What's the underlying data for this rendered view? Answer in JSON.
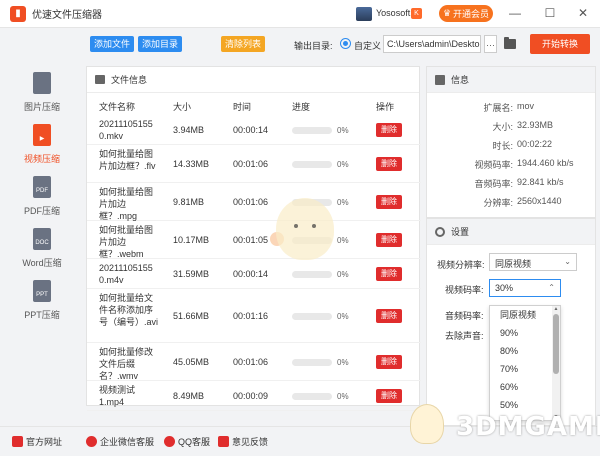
{
  "titlebar": {
    "app_icon": "film-icon",
    "title": "优速文件压缩器",
    "username": "Yososoft",
    "vip_label": "开通会员"
  },
  "toolbar": {
    "add_file": "添加文件",
    "add_dir": "添加目录",
    "clear_list": "清除列表",
    "output_label": "输出目录:",
    "custom_label": "自定义",
    "output_path": "C:\\Users\\admin\\Deskto",
    "browse_label": "···",
    "start_label": "开始转换"
  },
  "sidebar": {
    "items": [
      {
        "label": "图片压缩",
        "icon": "image-icon",
        "glyph": ""
      },
      {
        "label": "视频压缩",
        "icon": "video-icon",
        "glyph": "▶"
      },
      {
        "label": "PDF压缩",
        "icon": "pdf-icon",
        "glyph": "PDF"
      },
      {
        "label": "Word压缩",
        "icon": "doc-icon",
        "glyph": "DOC"
      },
      {
        "label": "PPT压缩",
        "icon": "ppt-icon",
        "glyph": "PPT"
      }
    ]
  },
  "file_panel": {
    "title": "文件信息",
    "columns": [
      "文件名称",
      "大小",
      "时间",
      "进度",
      "操作"
    ],
    "rows": [
      {
        "name": "20211105155 0.mkv",
        "size": "3.94MB",
        "time": "00:00:14",
        "progress": 0,
        "pct": "0%",
        "action": "删除"
      },
      {
        "name": "如何批量给图片加边框？.flv",
        "size": "14.33MB",
        "time": "00:01:06",
        "progress": 0,
        "pct": "0%",
        "action": "删除"
      },
      {
        "name": "如何批量给图片加边框？.mpg",
        "size": "9.81MB",
        "time": "00:01:06",
        "progress": 0,
        "pct": "0%",
        "action": "删除"
      },
      {
        "name": "如何批量给图片加边框？.webm",
        "size": "10.17MB",
        "time": "00:01:05",
        "progress": 0,
        "pct": "0%",
        "action": "删除"
      },
      {
        "name": "20211105155 0.m4v",
        "size": "31.59MB",
        "time": "00:00:14",
        "progress": 0,
        "pct": "0%",
        "action": "删除"
      },
      {
        "name": "如何批量给文件名称添加序号（编号）.avi",
        "size": "51.66MB",
        "time": "00:01:16",
        "progress": 0,
        "pct": "0%",
        "action": "删除"
      },
      {
        "name": "如何批量修改文件后缀名？.wmv",
        "size": "45.05MB",
        "time": "00:01:06",
        "progress": 0,
        "pct": "0%",
        "action": "删除"
      },
      {
        "name": "视频测试1.mp4",
        "size": "8.49MB",
        "time": "00:00:09",
        "progress": 0,
        "pct": "0%",
        "action": "删除"
      }
    ]
  },
  "info_panel": {
    "title": "信息",
    "items": [
      {
        "key": "扩展名:",
        "value": "mov"
      },
      {
        "key": "大小:",
        "value": "32.93MB"
      },
      {
        "key": "时长:",
        "value": "00:02:22"
      },
      {
        "key": "视频码率:",
        "value": "1944.460 kb/s"
      },
      {
        "key": "音频码率:",
        "value": "92.841 kb/s"
      },
      {
        "key": "分辨率:",
        "value": "2560x1440"
      }
    ]
  },
  "settings": {
    "title": "设置",
    "resolution_label": "视频分辨率:",
    "resolution_value": "同原视频",
    "bitrate_label": "视频码率:",
    "bitrate_value": "30%",
    "audio_label": "音频码率:",
    "mute_label": "去除声音:",
    "options": [
      "同原视频",
      "90%",
      "80%",
      "70%",
      "60%",
      "50%"
    ]
  },
  "footer": {
    "items": [
      {
        "label": "官方网址",
        "icon": "home-icon"
      },
      {
        "label": "企业微信客服",
        "icon": "wechat-icon"
      },
      {
        "label": "QQ客服",
        "icon": "qq-icon"
      },
      {
        "label": "意见反馈",
        "icon": "feedback-icon"
      }
    ]
  },
  "watermark": {
    "text": "3DMGAME"
  },
  "colors": {
    "accent": "#f04e23",
    "blue": "#2d8cf0",
    "orange": "#f4a623",
    "delete": "#e02d2d"
  }
}
